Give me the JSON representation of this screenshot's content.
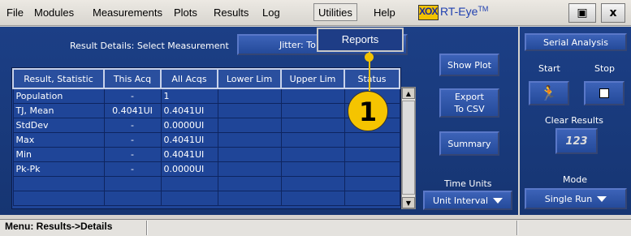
{
  "menubar": {
    "items": [
      "File",
      "Modules",
      "Measurements",
      "Plots",
      "Results",
      "Log",
      "Utilities",
      "Help"
    ],
    "active": "Utilities"
  },
  "app": {
    "logo": "XOX",
    "title": "RT-Eye",
    "tm": "TM"
  },
  "window_buttons": {
    "minimize_restore": "▣",
    "close": "x"
  },
  "result_details": {
    "label": "Result Details: Select Measurement",
    "measurement": "Jitter: To"
  },
  "popup_menu": {
    "items": [
      "Reports"
    ]
  },
  "callout": "1",
  "table": {
    "columns": [
      "Result, Statistic",
      "This Acq",
      "All Acqs",
      "Lower Lim",
      "Upper Lim",
      "Status"
    ],
    "rows": [
      [
        "Population",
        "-",
        "1",
        "",
        "",
        ""
      ],
      [
        "TJ, Mean",
        "0.4041UI",
        "0.4041UI",
        "",
        "",
        ""
      ],
      [
        "StdDev",
        "-",
        "0.0000UI",
        "",
        "",
        ""
      ],
      [
        "Max",
        "-",
        "0.4041UI",
        "",
        "",
        ""
      ],
      [
        "Min",
        "-",
        "0.4041UI",
        "",
        "",
        ""
      ],
      [
        "Pk-Pk",
        "-",
        "0.0000UI",
        "",
        "",
        ""
      ],
      [
        "",
        "",
        "",
        "",
        "",
        ""
      ],
      [
        "",
        "",
        "",
        "",
        "",
        ""
      ]
    ]
  },
  "actions": {
    "show_plot": "Show Plot",
    "export_line1": "Export",
    "export_line2": "To CSV",
    "summary": "Summary"
  },
  "time_units": {
    "label": "Time Units",
    "value": "Unit Interval"
  },
  "serial_analysis": {
    "title": "Serial Analysis",
    "start": "Start",
    "stop": "Stop",
    "clear_results": "Clear Results",
    "clear_icon_text": "123",
    "mode_label": "Mode",
    "mode_value": "Single Run"
  },
  "statusbar": {
    "text": "Menu: Results->Details"
  },
  "colors": {
    "panel": "#1c3f86",
    "callout": "#f5c400",
    "accent": "#2a4f9e"
  }
}
